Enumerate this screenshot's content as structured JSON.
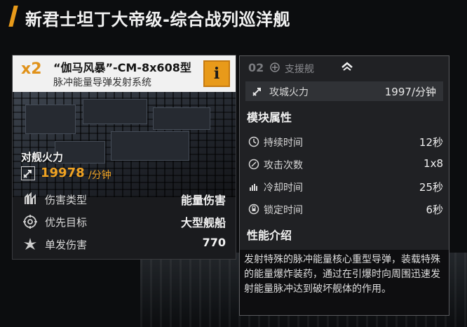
{
  "page": {
    "title": "新君士坦丁大帝级-综合战列巡洋舰"
  },
  "weapon": {
    "quantity": "x2",
    "name": "“伽马风暴”-CM-8x608型",
    "system": "脉冲能量导弹发射系统",
    "info_label": "i",
    "firepower_label": "对舰火力",
    "firepower_value": "19978",
    "firepower_unit": "/分钟",
    "stats": [
      {
        "label": "伤害类型",
        "value": "能量伤害",
        "icon": "damage-type-icon"
      },
      {
        "label": "优先目标",
        "value": "大型舰船",
        "icon": "target-icon"
      },
      {
        "label": "单发伤害",
        "value": "770",
        "icon": "burst-damage-icon"
      }
    ]
  },
  "panel": {
    "ship_index": "02",
    "ship_role": "支援舰",
    "siege_label": "攻城火力",
    "siege_value": "1997/分钟",
    "module_title": "模块属性",
    "attributes": [
      {
        "label": "持续时间",
        "value": "12秒",
        "icon": "clock-icon"
      },
      {
        "label": "攻击次数",
        "value": "1x8",
        "icon": "attack-count-icon"
      },
      {
        "label": "冷却时间",
        "value": "25秒",
        "icon": "cooldown-icon"
      },
      {
        "label": "锁定时间",
        "value": "6秒",
        "icon": "lock-on-icon"
      }
    ],
    "perf_title": "性能介绍",
    "description": "发射特殊的脉冲能量核心重型导弹，装载特殊的能量爆炸装药，通过在引爆时向周围迅速发射能量脉冲达到破坏舰体的作用。"
  },
  "colors": {
    "accent": "#e89a1a",
    "firepower": "#f0a323",
    "panel_bg": "#202124"
  }
}
